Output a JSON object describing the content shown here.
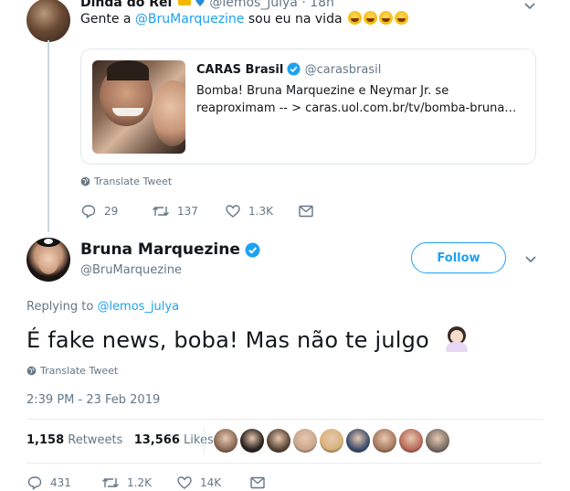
{
  "parent_tweet": {
    "display_name": "Dinda do Rei",
    "handle": "@lemos_julya",
    "time": "18h",
    "text_prefix": "Gente a",
    "mention": "@BruMarquezine",
    "text_suffix": "sou eu na vida",
    "translate_label": "Translate Tweet",
    "card": {
      "source_name": "CARAS Brasil",
      "source_handle": "@carasbrasil",
      "description": "Bomba! Bruna Marquezine e Neymar Jr. se reaproximam -- > caras.uol.com.br/tv/bomba-bruna…"
    },
    "actions": {
      "replies": "29",
      "retweets": "137",
      "likes": "1.3K"
    }
  },
  "main_tweet": {
    "display_name": "Bruna Marquezine",
    "handle": "@BruMarquezine",
    "follow_label": "Follow",
    "replying_label": "Replying to",
    "replying_handle": "@lemos_julya",
    "text": "É fake news, boba! Mas não te julgo",
    "translate_label": "Translate Tweet",
    "timestamp": "2:39 PM - 23 Feb 2019",
    "retweets_count": "1,158",
    "retweets_label": "Retweets",
    "likes_count": "13,566",
    "likes_label": "Likes",
    "actions": {
      "replies": "431",
      "retweets": "1.2K",
      "likes": "14K"
    }
  },
  "colors": {
    "accent": "#1da1f2",
    "muted": "#657786",
    "border": "#e1e8ed"
  },
  "liker_avatars": [
    "#8a6a54",
    "#2b2320",
    "#5b4636",
    "#c9a78d",
    "#d8b27a",
    "#3e4e6c",
    "#a77a5f",
    "#b96a5a",
    "#7c6f66"
  ]
}
